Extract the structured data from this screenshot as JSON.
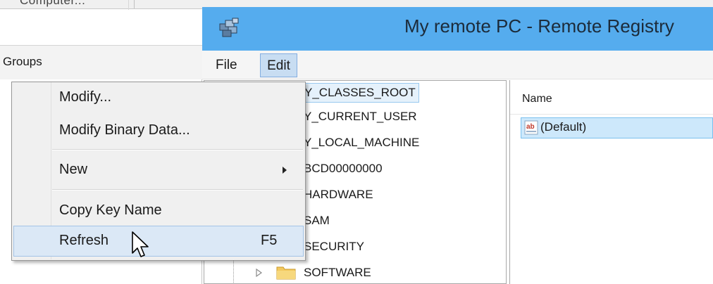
{
  "host_app": {
    "tab_partial": "Computer...",
    "groups_label": "Groups"
  },
  "window": {
    "title": "My remote PC - Remote Registry",
    "icon": "registry-icon"
  },
  "menu": {
    "items": [
      "File",
      "Edit"
    ],
    "active": "Edit"
  },
  "tree": {
    "items": [
      "Y_CLASSES_ROOT",
      "Y_CURRENT_USER",
      "Y_LOCAL_MACHINE",
      "BCD00000000",
      "HARDWARE",
      "SAM",
      "SECURITY",
      "SOFTWARE"
    ],
    "selected": "Y_CLASSES_ROOT"
  },
  "values_list": {
    "column_name": "Name",
    "rows": [
      {
        "name": "(Default)",
        "icon": "string-value-icon"
      }
    ]
  },
  "context_menu": {
    "items": [
      {
        "label": "Modify..."
      },
      {
        "label": "Modify Binary Data..."
      },
      {
        "label": "New",
        "submenu": true
      },
      {
        "label": "Copy Key Name"
      },
      {
        "label": "Refresh",
        "shortcut": "F5",
        "highlighted": true
      }
    ]
  },
  "colors": {
    "title_bar": "#55acee",
    "menu_active_bg": "#c8ddf2",
    "selection_bg": "#cde8fb",
    "context_highlight": "#dbe8f6"
  }
}
